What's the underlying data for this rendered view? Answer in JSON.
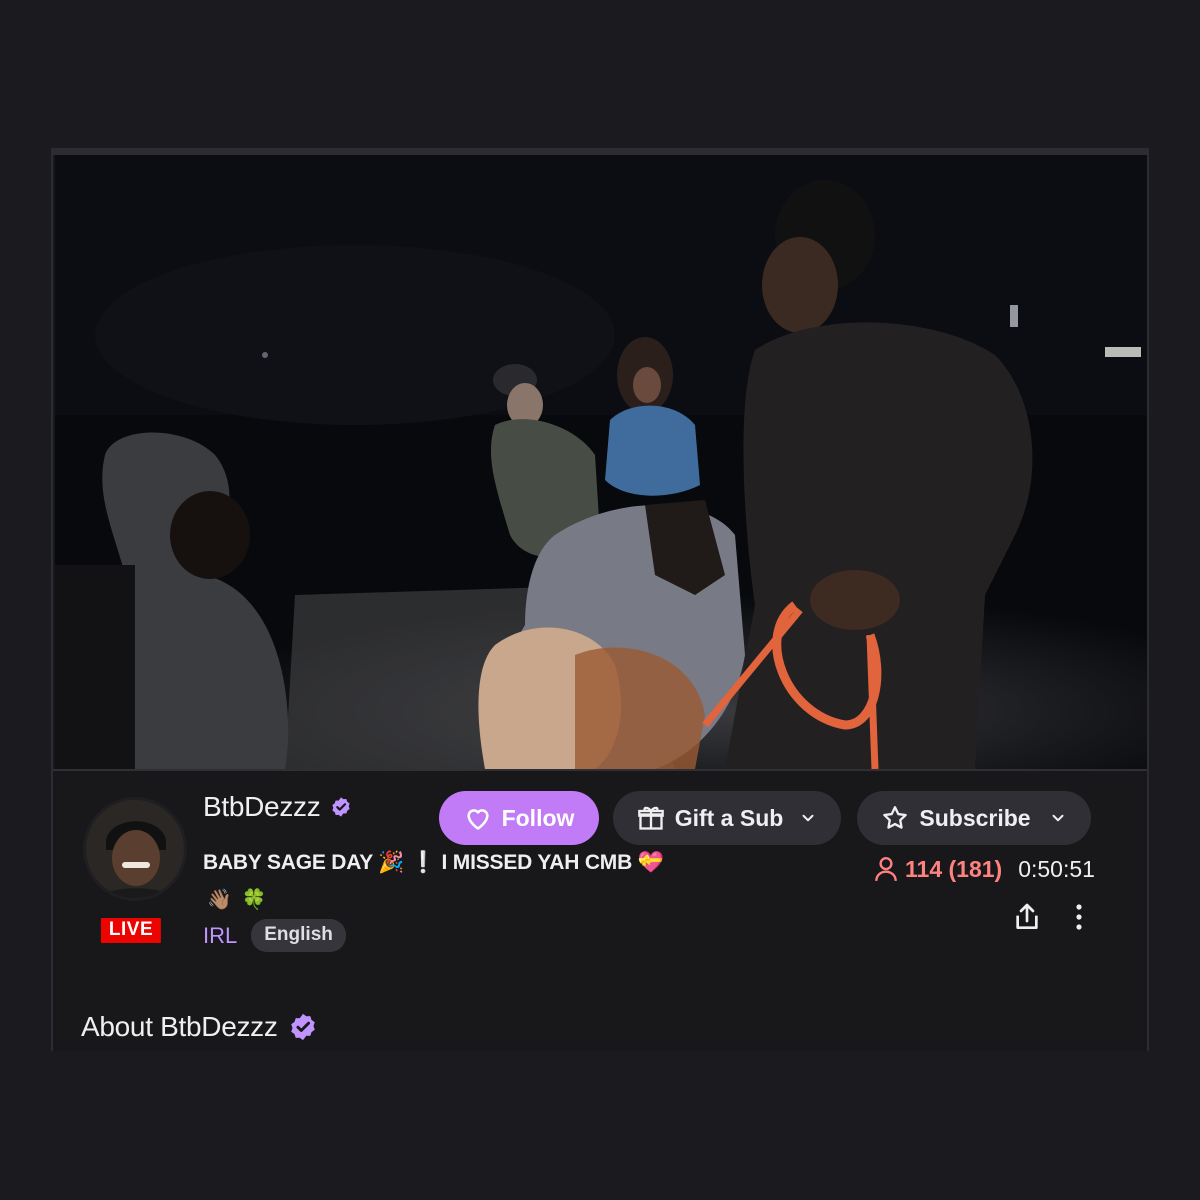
{
  "channel": {
    "name": "BtbDezzz",
    "live_label": "LIVE",
    "stream_title": "BABY SAGE DAY 🎉 ❕ I MISSED YAH CMB 💝",
    "title_emojis": [
      "👋🏽",
      "🍀"
    ],
    "category": "IRL",
    "tags": [
      "English"
    ]
  },
  "actions": {
    "follow_label": "Follow",
    "gift_label": "Gift a Sub",
    "subscribe_label": "Subscribe"
  },
  "stats": {
    "viewers": "114 (181)",
    "uptime": "0:50:51"
  },
  "about": {
    "heading": "About BtbDezzz"
  },
  "colors": {
    "accent": "#bf94ff",
    "live": "#eb0400",
    "viewers": "#ff8280"
  },
  "icons": {
    "follow": "heart-icon",
    "gift": "gift-icon",
    "subscribe": "star-icon",
    "chevron": "chevron-down-icon",
    "viewers": "person-icon",
    "share": "share-icon",
    "more": "more-vertical-icon",
    "verified": "verified-badge-icon"
  }
}
